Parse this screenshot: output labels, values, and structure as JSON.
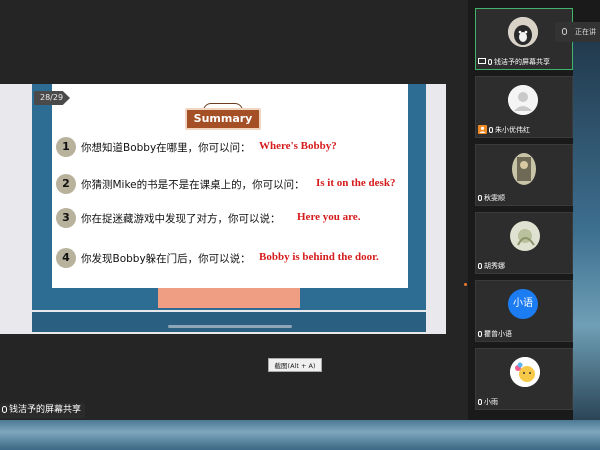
{
  "slide": {
    "page": "28/29",
    "summary_title": "Summary",
    "questions": [
      {
        "num": "1",
        "zh": "你想知道Bobby在哪里，你可以问：",
        "en": "Where's Bobby?"
      },
      {
        "num": "2",
        "zh": "你猜测Mike的书是不是在课桌上的，你可以问：",
        "en": "Is it on the desk?"
      },
      {
        "num": "3",
        "zh": "你在捉迷藏游戏中发现了对方，你可以说：",
        "en": "Here you are."
      },
      {
        "num": "4",
        "zh": "你发现Bobby躲在门后，你可以说：",
        "en": "Bobby is behind the door."
      }
    ]
  },
  "tooltip": "截图(Alt + A)",
  "share_label": "钱洁予的屏幕共享",
  "talking_label": "正在讲",
  "participants": [
    {
      "name": "钱洁予的屏幕共享",
      "avatar": "dog-photo-avatar"
    },
    {
      "name": "朱小优伟红",
      "avatar": "default-person-avatar"
    },
    {
      "name": "秋雯顺",
      "avatar": "photo-avatar"
    },
    {
      "name": "胡秀娜",
      "avatar": "photo-avatar"
    },
    {
      "name": "瞿曾小语",
      "avatar": "text-avatar",
      "avatar_text": "小语"
    },
    {
      "name": "小雨",
      "avatar": "emoji-avatar"
    }
  ],
  "colors": {
    "accent_green": "#43b36b",
    "slide_blue": "#2d6d93",
    "answer_red": "#d51b1b",
    "plank_brown": "#a44f25"
  }
}
